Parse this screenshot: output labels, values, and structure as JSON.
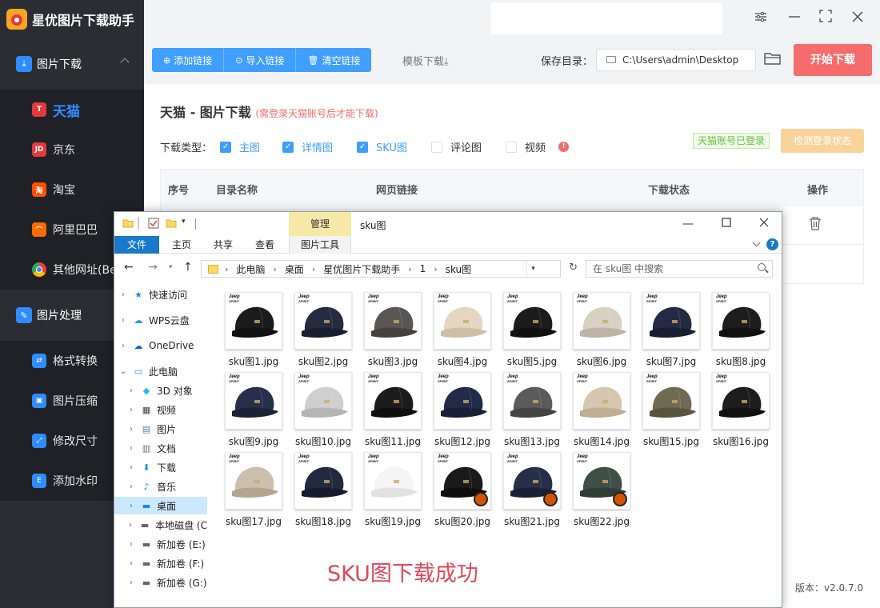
{
  "app": {
    "title": "星优图片下载助手",
    "window_controls": [
      "settings-icon",
      "minimize-icon",
      "maximize-icon",
      "close-icon"
    ]
  },
  "sidebar": {
    "group1": {
      "label": "图片下载"
    },
    "sub_items": [
      {
        "label": "天猫",
        "badge": "T",
        "color": "#e4393c",
        "active": true
      },
      {
        "label": "京东",
        "badge": "JD",
        "color": "#e4393c",
        "active": false
      },
      {
        "label": "淘宝",
        "badge": "淘",
        "color": "#ff5000",
        "active": false
      },
      {
        "label": "阿里巴巴",
        "badge": "⌒",
        "color": "#ff6a00",
        "active": false
      },
      {
        "label": "其他网址(Be",
        "badge": "",
        "color": "#4285f4",
        "active": false
      }
    ],
    "group2": {
      "label": "图片处理"
    },
    "tools": [
      {
        "label": "格式转换"
      },
      {
        "label": "图片压缩"
      },
      {
        "label": "修改尺寸"
      },
      {
        "label": "添加水印"
      }
    ]
  },
  "toolbar": {
    "add_link": "添加链接",
    "import_link": "导入链接",
    "clear_link": "清空链接",
    "template": "模板下载⤓",
    "save_label": "保存目录：",
    "save_path": "C:\\Users\\admin\\Desktop",
    "start": "开始下载"
  },
  "panel": {
    "title": "天猫 - 图片下载",
    "note": "(需登录天猫账号后才能下载)",
    "type_label": "下载类型：",
    "types": [
      {
        "label": "主图",
        "checked": true
      },
      {
        "label": "详情图",
        "checked": true
      },
      {
        "label": "SKU图",
        "checked": true
      },
      {
        "label": "评论图",
        "checked": false
      },
      {
        "label": "视频",
        "checked": false
      }
    ],
    "logged_badge": "天猫账号已登录",
    "check_login": "检测登录状态",
    "columns": [
      "序号",
      "目录名称",
      "网页链接",
      "下载状态",
      "操作"
    ],
    "version": "版本：v2.0.7.0"
  },
  "explorer": {
    "manage_tab": "管理",
    "folder_name": "sku图",
    "ribbon_tabs": [
      "文件",
      "主页",
      "共享",
      "查看",
      "图片工具"
    ],
    "breadcrumb": [
      "此电脑",
      "桌面",
      "星优图片下载助手",
      "1",
      "sku图"
    ],
    "search_placeholder": "在 sku图 中搜索",
    "tree": [
      {
        "label": "快速访问",
        "icon": "star-icon",
        "level": 0
      },
      {
        "label": "WPS云盘",
        "icon": "cloud-icon",
        "level": 0
      },
      {
        "label": "OneDrive",
        "icon": "onedrive-icon",
        "level": 0
      },
      {
        "label": "此电脑",
        "icon": "computer-icon",
        "level": 0
      },
      {
        "label": "3D 对象",
        "icon": "cube-icon",
        "level": 1
      },
      {
        "label": "视频",
        "icon": "video-icon",
        "level": 1
      },
      {
        "label": "图片",
        "icon": "picture-icon",
        "level": 1
      },
      {
        "label": "文档",
        "icon": "document-icon",
        "level": 1
      },
      {
        "label": "下载",
        "icon": "download-icon",
        "level": 1
      },
      {
        "label": "音乐",
        "icon": "music-icon",
        "level": 1
      },
      {
        "label": "桌面",
        "icon": "desktop-icon",
        "level": 1,
        "selected": true
      },
      {
        "label": "本地磁盘 (C",
        "icon": "disk-icon",
        "level": 1
      },
      {
        "label": "新加卷 (E:)",
        "icon": "disk-icon",
        "level": 1
      },
      {
        "label": "新加卷 (F:)",
        "icon": "disk-icon",
        "level": 1
      },
      {
        "label": "新加卷 (G:)",
        "icon": "disk-icon",
        "level": 1
      }
    ],
    "files": [
      {
        "name": "sku图1.jpg",
        "cap": "#1b1b1b",
        "brim": "#111"
      },
      {
        "name": "sku图2.jpg",
        "cap": "#252c40",
        "brim": "#1a1f30"
      },
      {
        "name": "sku图3.jpg",
        "cap": "#5a5654",
        "brim": "#454140"
      },
      {
        "name": "sku图4.jpg",
        "cap": "#e4d6c0",
        "brim": "#cdbfa8"
      },
      {
        "name": "sku图5.jpg",
        "cap": "#1c1c1c",
        "brim": "#101010"
      },
      {
        "name": "sku图6.jpg",
        "cap": "#d8d0c2",
        "brim": "#bdb4a5"
      },
      {
        "name": "sku图7.jpg",
        "cap": "#232a42",
        "brim": "#181d30"
      },
      {
        "name": "sku图8.jpg",
        "cap": "#1d1d1d",
        "brim": "#111"
      },
      {
        "name": "sku图9.jpg",
        "cap": "#27304a",
        "brim": "#1b2236"
      },
      {
        "name": "sku图10.jpg",
        "cap": "#cfcfcf",
        "brim": "#b5b5b5"
      },
      {
        "name": "sku图11.jpg",
        "cap": "#1c1c1c",
        "brim": "#0f0f0f"
      },
      {
        "name": "sku图12.jpg",
        "cap": "#222b48",
        "brim": "#171e36"
      },
      {
        "name": "sku图13.jpg",
        "cap": "#5b5b5b",
        "brim": "#444"
      },
      {
        "name": "sku图14.jpg",
        "cap": "#d6c6ad",
        "brim": "#bfae93"
      },
      {
        "name": "sku图15.jpg",
        "cap": "#6f6a52",
        "brim": "#57533f"
      },
      {
        "name": "sku图16.jpg",
        "cap": "#1d1d1d",
        "brim": "#111"
      },
      {
        "name": "sku图17.jpg",
        "cap": "#cbbfae",
        "brim": "#b2a592"
      },
      {
        "name": "sku图18.jpg",
        "cap": "#222a40",
        "brim": "#161c2e"
      },
      {
        "name": "sku图19.jpg",
        "cap": "#f5f5f5",
        "brim": "#e2e2e2"
      },
      {
        "name": "sku图20.jpg",
        "cap": "#1a1a1a",
        "brim": "#0e0e0e",
        "promo": true
      },
      {
        "name": "sku图21.jpg",
        "cap": "#262e48",
        "brim": "#1a2034",
        "promo": true
      },
      {
        "name": "sku图22.jpg",
        "cap": "#3f4e46",
        "brim": "#303c36",
        "promo": true
      }
    ],
    "thumb_brand": "Jeep",
    "thumb_brand_sub": "SPIRIT",
    "success_text": "SKU图下载成功"
  },
  "colors": {
    "sidebar_bg": "#2b2d33",
    "primary": "#409eff",
    "danger": "#f56c6c",
    "success_text": "#e4475a"
  }
}
